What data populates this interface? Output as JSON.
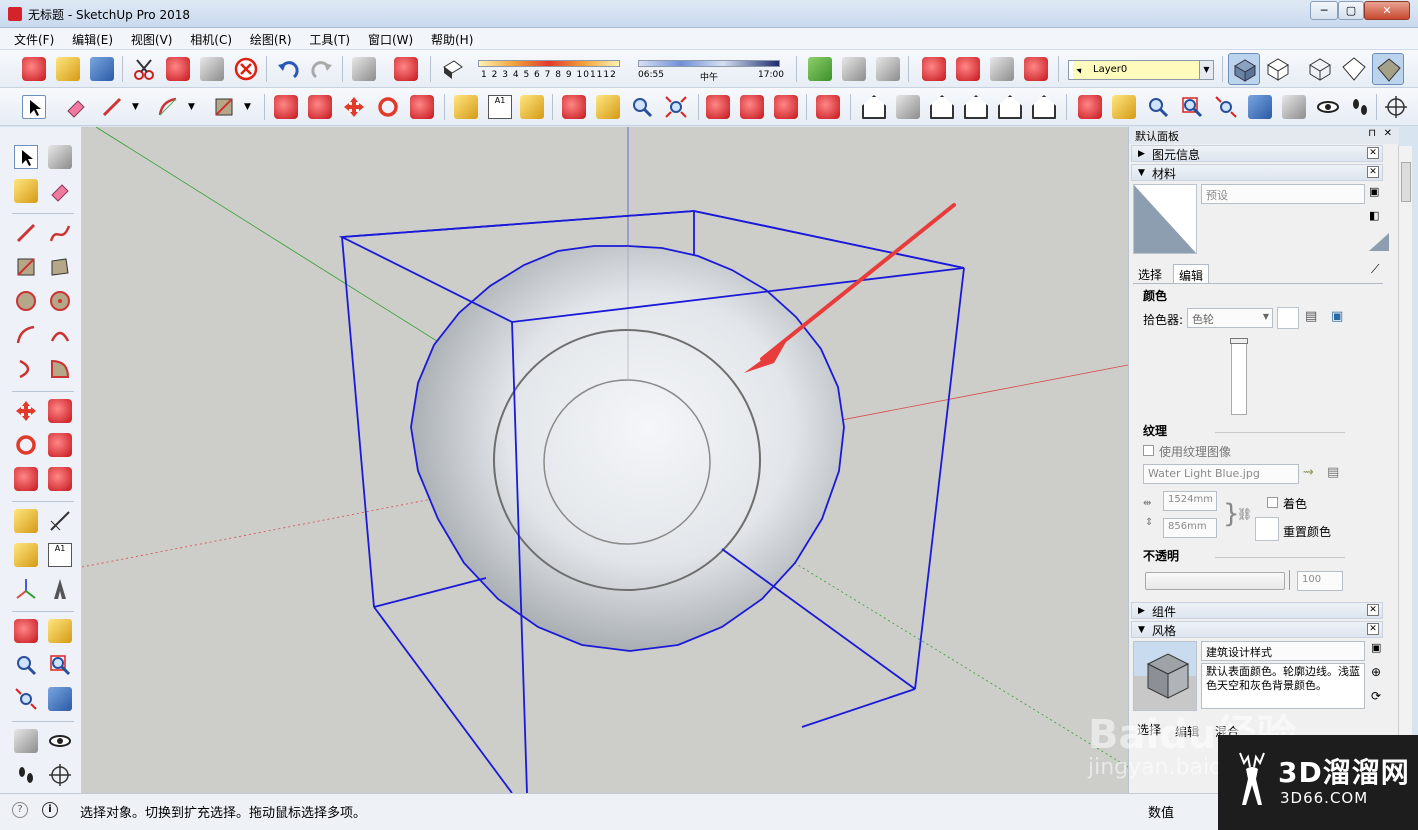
{
  "window": {
    "title": "无标题 - SketchUp Pro 2018",
    "min": "─",
    "max": "▢",
    "close": "✕"
  },
  "menu": [
    "文件(F)",
    "编辑(E)",
    "视图(V)",
    "相机(C)",
    "绘图(R)",
    "工具(T)",
    "窗口(W)",
    "帮助(H)"
  ],
  "shadow": {
    "months": [
      "1",
      "2",
      "3",
      "4",
      "5",
      "6",
      "7",
      "8",
      "9",
      "10",
      "11",
      "12"
    ],
    "time_start": "06:55",
    "time_mid": "中午",
    "time_end": "17:00"
  },
  "layer": {
    "name": "Layer0"
  },
  "tray": {
    "title": "默认面板",
    "pin": "⊓",
    "close": "✕",
    "entity_info": {
      "label": "图元信息"
    },
    "materials": {
      "label": "材料",
      "name_value": "预设",
      "tabs": [
        "选择",
        "编辑"
      ],
      "color_heading": "颜色",
      "picker_label": "拾色器:",
      "picker_value": "色轮",
      "texture_heading": "纹理",
      "use_texture": "使用纹理图像",
      "texture_file": "Water Light Blue.jpg",
      "width": "1524mm",
      "height": "856mm",
      "colorize": "着色",
      "reset_color": "重置颜色",
      "opacity_heading": "不透明",
      "opacity_value": "100"
    },
    "components": {
      "label": "组件"
    },
    "styles": {
      "label": "风格",
      "style_name": "建筑设计样式",
      "description": "默认表面颜色。轮廓边线。浅蓝色天空和灰色背景颜色。",
      "tabs": [
        "选择",
        "编辑",
        "混合"
      ]
    }
  },
  "status": {
    "message": "选择对象。切换到扩充选择。拖动鼠标选择多项。",
    "measure_label": "数值"
  },
  "watermarks": {
    "baidu": "Baidu经验",
    "jingyan": "jingyan.baidu",
    "site_main": "3D溜溜网",
    "site_sub": "3D66.COM"
  },
  "colors": {
    "selection": "#1a1ad8",
    "annotation_arrow": "#e83c3c",
    "axis_red": "#d84848",
    "axis_green": "#2e9e2e",
    "axis_blue": "#4a5ad8"
  }
}
